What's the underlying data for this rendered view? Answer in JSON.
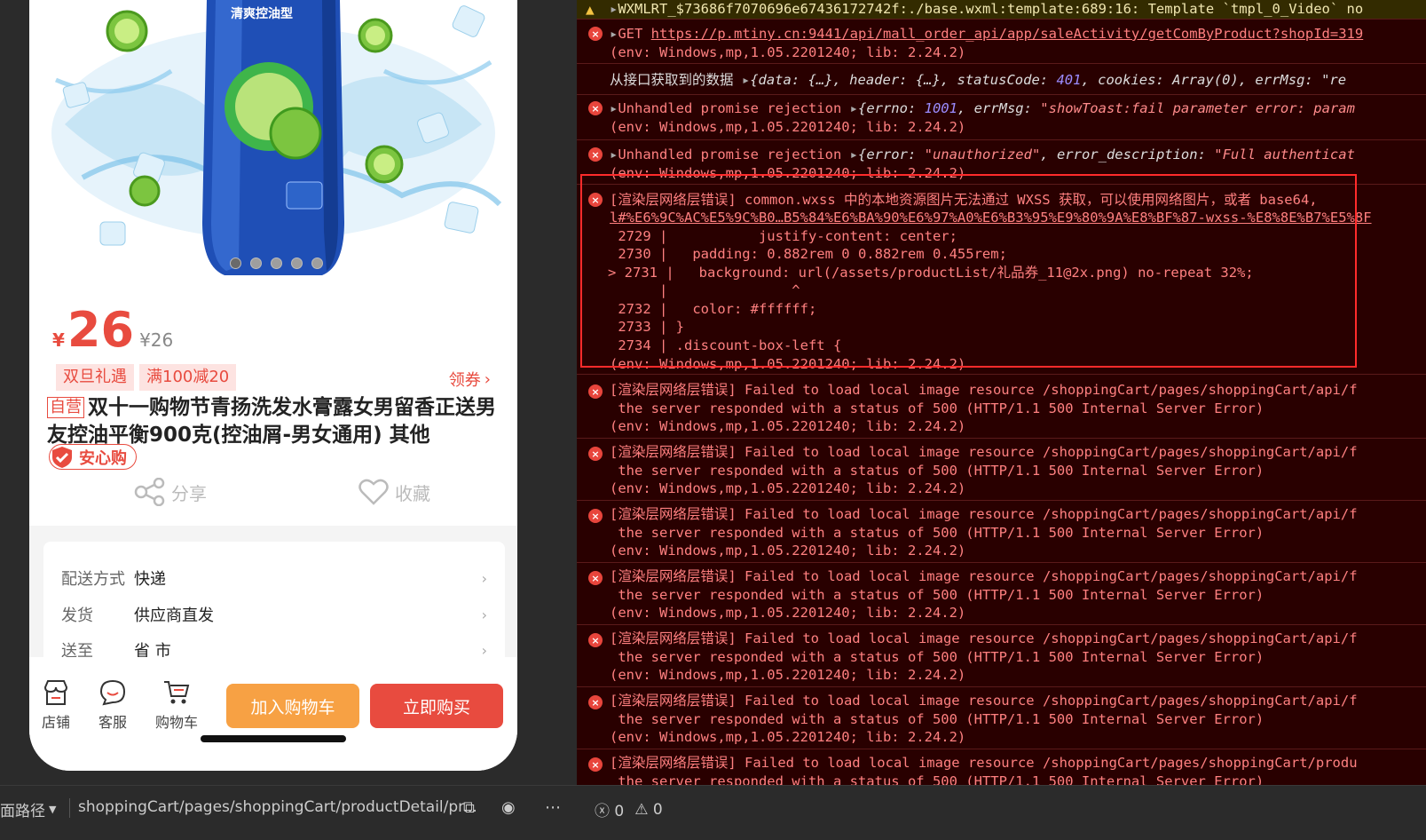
{
  "product": {
    "price_currency": "¥",
    "price_value": "26",
    "original_price": "¥26",
    "tags": [
      "双旦礼遇",
      "满100减20"
    ],
    "coupon_label": "领券",
    "self_operated": "自营",
    "title": "双十一购物节青扬洗发水膏露女男留香正送男友控油平衡900克(控油屑-男女通用) 其他",
    "anxin_label": "安心购",
    "share_label": "分享",
    "favorite_label": "收藏",
    "carousel_count": 5,
    "carousel_active": 0,
    "bottle_label": "清爽控油型"
  },
  "info": [
    {
      "label": "配送方式",
      "value": "快递"
    },
    {
      "label": "发货",
      "value": "供应商直发"
    },
    {
      "label": "送至",
      "value": "省 市"
    }
  ],
  "bottom_nav": {
    "store": "店铺",
    "service": "客服",
    "cart": "购物车",
    "add_to_cart": "加入购物车",
    "buy_now": "立即购买"
  },
  "sim_status": {
    "path_label": "面路径",
    "path": "shoppingCart/pages/shoppingCart/productDetail/pr..."
  },
  "console": {
    "error_count": "0",
    "warning_count": "0",
    "logs": {
      "warn_line": "WXMLRT_$73686f7070696e67436172742f:./base.wxml:template:689:16: Template `tmpl_0_Video` no",
      "get_prefix": "GET ",
      "get_url": "https://p.mtiny.cn:9441/api/mall_order_api/app/saleActivity/getComByProduct?shopId=319",
      "env": "(env: Windows,mp,1.05.2201240; lib: 2.24.2)",
      "info_prefix": "从接口获取到的数据 ",
      "info_body_1": "{data: {…}, header: {…}, statusCode: ",
      "info_status": "401",
      "info_body_2": ", cookies: Array(0), errMsg: \"re",
      "unhandled": "Unhandled promise rejection ",
      "rej1_1": "{errno: ",
      "rej1_num": "1001",
      "rej1_2": ", errMsg: ",
      "rej1_str": "\"showToast:fail parameter error: param",
      "rej2_1": "{error: ",
      "rej2_str1": "\"unauthorized\"",
      "rej2_2": ", error_description: ",
      "rej2_str2": "\"Full authenticat",
      "wxss_1": "[渲染层网络层错误] common.wxss 中的本地资源图片无法通过 WXSS 获取，可以使用网络图片，或者 base64,",
      "wxss_2": "l#%E6%9C%AC%E5%9C%B0…B5%84%E6%BA%90%E6%97%A0%E6%B3%95%E9%80%9A%E8%BF%87-wxss-%E8%8E%B7%E5%8F",
      "code_1": " 2729 |           justify-content: center;",
      "code_2": " 2730 |   padding: 0.882rem 0 0.882rem 0.455rem;",
      "code_3": "> 2731 |   background: url(/assets/productList/礼品券_11@2x.png) no-repeat 32%;",
      "code_4": "      |               ^",
      "code_5": " 2732 |   color: #ffffff;",
      "code_6": " 2733 | }",
      "code_7": " 2734 | .discount-box-left {",
      "load_1": "[渲染层网络层错误] Failed to load local image resource /shoppingCart/pages/shoppingCart/api/f",
      "load_1b": "[渲染层网络层错误] Failed to load local image resource /shoppingCart/pages/shoppingCart/produ",
      "load_2": " the server responded with a status of 500 (HTTP/1.1 500 Internal Server Error)"
    }
  },
  "colors": {
    "accent_red": "#e84b3f",
    "accent_orange": "#f7a144",
    "console_bg": "#290000"
  }
}
